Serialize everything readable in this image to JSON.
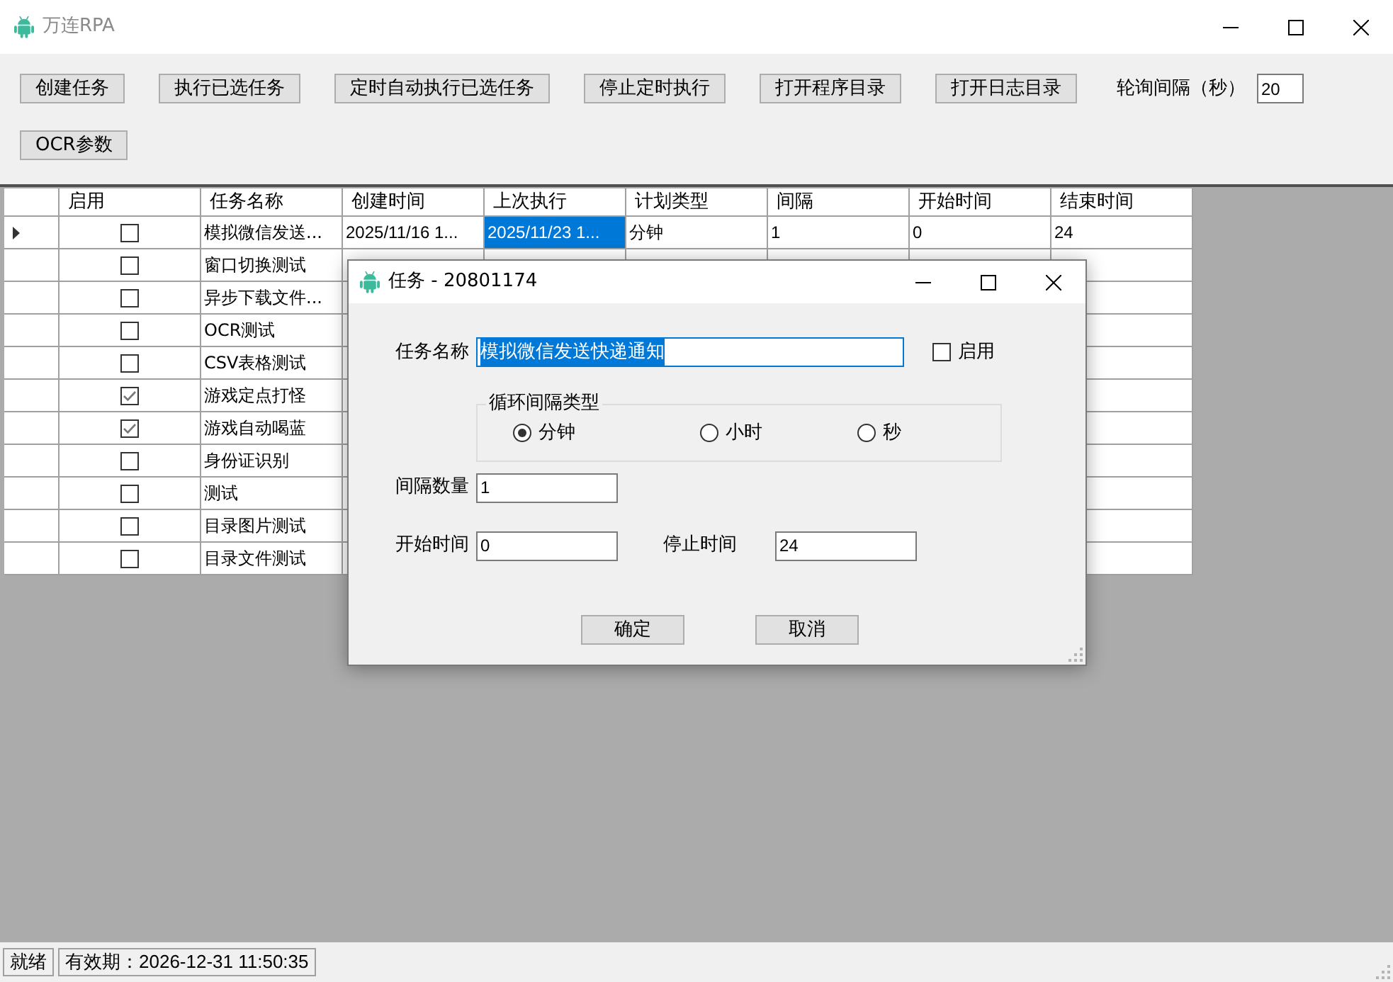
{
  "window": {
    "title": "万连RPA"
  },
  "toolbar": {
    "buttons": [
      "创建任务",
      "执行已选任务",
      "定时自动执行已选任务",
      "停止定时执行",
      "打开程序目录",
      "打开日志目录"
    ],
    "poll_label": "轮询间隔（秒）",
    "poll_value": "20",
    "second_row_buttons": [
      "OCR参数"
    ]
  },
  "table": {
    "columns": [
      "启用",
      "任务名称",
      "创建时间",
      "上次执行",
      "计划类型",
      "间隔",
      "开始时间",
      "结束时间"
    ],
    "rows": [
      {
        "current": true,
        "enabled": false,
        "name": "模拟微信发送...",
        "cells": [
          {
            "text": "2025/11/16 1...",
            "selected": false
          },
          {
            "text": "2025/11/23 1...",
            "selected": true
          },
          {
            "text": "分钟",
            "selected": false
          },
          {
            "text": "1",
            "selected": false
          },
          {
            "text": "0",
            "selected": false
          },
          {
            "text": "24",
            "selected": false
          }
        ]
      },
      {
        "current": false,
        "enabled": false,
        "name": "窗口切换测试"
      },
      {
        "current": false,
        "enabled": false,
        "name": "异步下载文件..."
      },
      {
        "current": false,
        "enabled": false,
        "name": "OCR测试"
      },
      {
        "current": false,
        "enabled": false,
        "name": "CSV表格测试"
      },
      {
        "current": false,
        "enabled": true,
        "name": "游戏定点打怪"
      },
      {
        "current": false,
        "enabled": true,
        "name": "游戏自动喝蓝"
      },
      {
        "current": false,
        "enabled": false,
        "name": "身份证识别"
      },
      {
        "current": false,
        "enabled": false,
        "name": "测试"
      },
      {
        "current": false,
        "enabled": false,
        "name": "目录图片测试"
      },
      {
        "current": false,
        "enabled": false,
        "name": "目录文件测试"
      }
    ]
  },
  "dialog": {
    "title": "任务 - 20801174",
    "name_label": "任务名称",
    "name_value": "模拟微信发送快递通知",
    "name_highlighted": true,
    "enabled_label": "启用",
    "enabled_checked": false,
    "interval_group": {
      "legend": "循环间隔类型",
      "options": [
        {
          "label": "分钟",
          "selected": true
        },
        {
          "label": "小时",
          "selected": false
        },
        {
          "label": "秒",
          "selected": false
        }
      ]
    },
    "count_label": "间隔数量",
    "count_value": "1",
    "start_label": "开始时间",
    "start_value": "0",
    "stop_label": "停止时间",
    "stop_value": "24",
    "buttons": [
      "确定",
      "取消"
    ]
  },
  "status_bar": {
    "panels": [
      "就绪",
      "有效期：2026-12-31 11:50:35"
    ]
  }
}
